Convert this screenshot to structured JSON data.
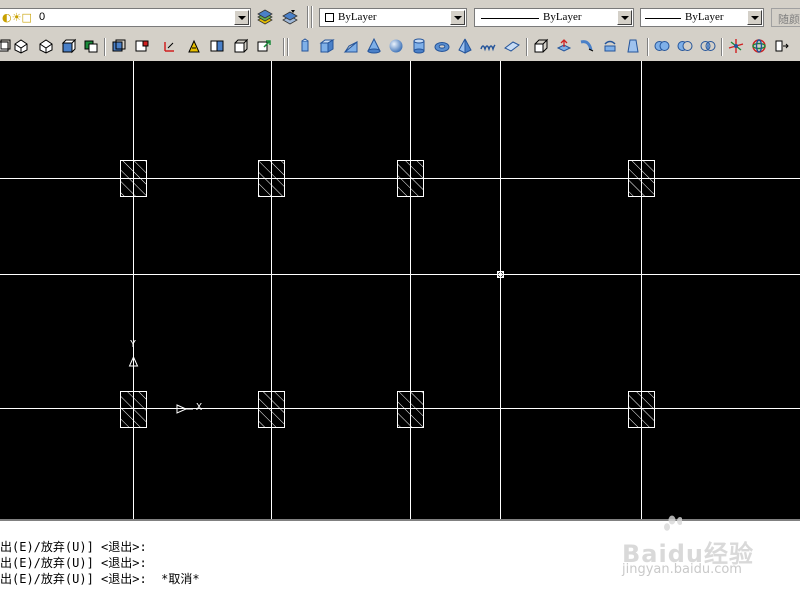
{
  "toolbar": {
    "layer": {
      "name": "0"
    },
    "color": {
      "value": "ByLayer"
    },
    "linetype": {
      "value": "ByLayer"
    },
    "lineweight": {
      "value": "ByLayer"
    },
    "plotstyle": {
      "value": "随颜色"
    }
  },
  "toolbar_icons": [
    "box-icon",
    "wedge-icon",
    "pyramid-icon",
    "cone-icon",
    "sphere-icon",
    "cylinder-icon",
    "torus-icon",
    "extrude-icon",
    "helix-icon",
    "planar-surface-icon",
    "union-icon",
    "subtract-icon",
    "intersect-icon",
    "orbit-icon",
    "render-icon"
  ],
  "ucs": {
    "x_label": "X",
    "y_label": "Y"
  },
  "command_lines": [
    "出(E)/放弃(U)] <退出>:",
    "出(E)/放弃(U)] <退出>:",
    "出(E)/放弃(U)] <退出>:  *取消*"
  ],
  "watermark": {
    "brand": "Baidu经验",
    "url": "jingyan.baidu.com"
  },
  "colors": {
    "canvas": "#000000",
    "grid": "#ffffff",
    "toolbar": "#d4d0c8"
  }
}
